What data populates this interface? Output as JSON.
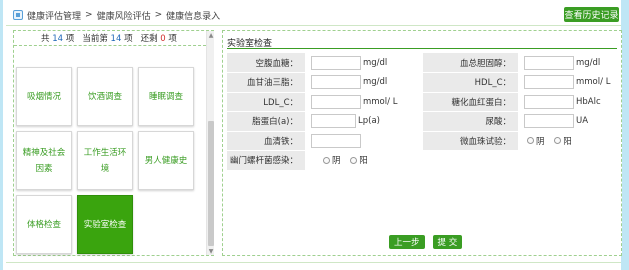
{
  "breadcrumb": {
    "items": [
      "健康评估管理",
      "健康风险评估",
      "健康信息录入"
    ],
    "sep": ">"
  },
  "header": {
    "history_button": "查看历史记录"
  },
  "counter": {
    "total_prefix": "共",
    "total": "14",
    "total_suffix": "项",
    "current_prefix": "当前第",
    "current": "14",
    "current_suffix": "项",
    "remaining_prefix": "还剩",
    "remaining": "0",
    "remaining_suffix": "项"
  },
  "tiles": [
    "吸烟情况",
    "饮酒调查",
    "睡眠调查",
    "精神及社会因素",
    "工作生活环境",
    "男人健康史",
    "体格检查",
    "实验室检查"
  ],
  "active_tile": "实验室检查",
  "section": {
    "title": "实验室检查"
  },
  "form": {
    "row1": {
      "label_a": "空腹血糖：",
      "unit_a": "mg/dl",
      "label_b": "血总胆固醇：",
      "unit_b": "mg/dl"
    },
    "row2": {
      "label_a": "血甘油三脂：",
      "unit_a": "mg/dl",
      "label_b": "HDL_C：",
      "unit_b": "mmol/ L"
    },
    "row3": {
      "label_a": "LDL_C：",
      "unit_a": "mmol/ L",
      "label_b": "糖化血红蛋白：",
      "unit_b": "HbAlc"
    },
    "row4": {
      "label_a": "脂蛋白(a)：",
      "unit_a": "Lp(a)",
      "label_b": "尿酸：",
      "unit_b": "UA"
    },
    "row5": {
      "label_a": "血清铁：",
      "label_b": "微血珠试验：",
      "opt_pos": "阴",
      "opt_neg": "阳"
    },
    "row6": {
      "label_a": "幽门螺杆菌感染：",
      "opt_pos": "阴",
      "opt_neg": "阳"
    }
  },
  "buttons": {
    "prev": "上一步",
    "submit": "提 交"
  },
  "colors": {
    "accent_green": "#3a9d23",
    "active_tile": "#3aa40e",
    "link_blue": "#1e66b8",
    "warn_red": "#d12e2e"
  }
}
